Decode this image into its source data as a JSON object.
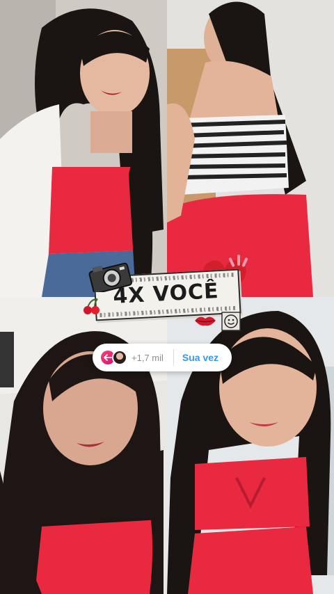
{
  "sticker": {
    "title": "4X VOCÊ"
  },
  "add_yours": {
    "count": "+1,7 mil",
    "cta": "Sua vez"
  },
  "photos": [
    {
      "name": "photo-top-left",
      "description_icon": "selfie-white-cardigan"
    },
    {
      "name": "photo-top-right",
      "description_icon": "pose-striped-top"
    },
    {
      "name": "photo-bottom-left",
      "description_icon": "selfie-red-top"
    },
    {
      "name": "photo-bottom-right",
      "description_icon": "selfie-red-outfit"
    }
  ],
  "colors": {
    "red_outfit": "#e8293f",
    "cta_blue": "#3797f0",
    "reply_pink": "#e3226f"
  }
}
